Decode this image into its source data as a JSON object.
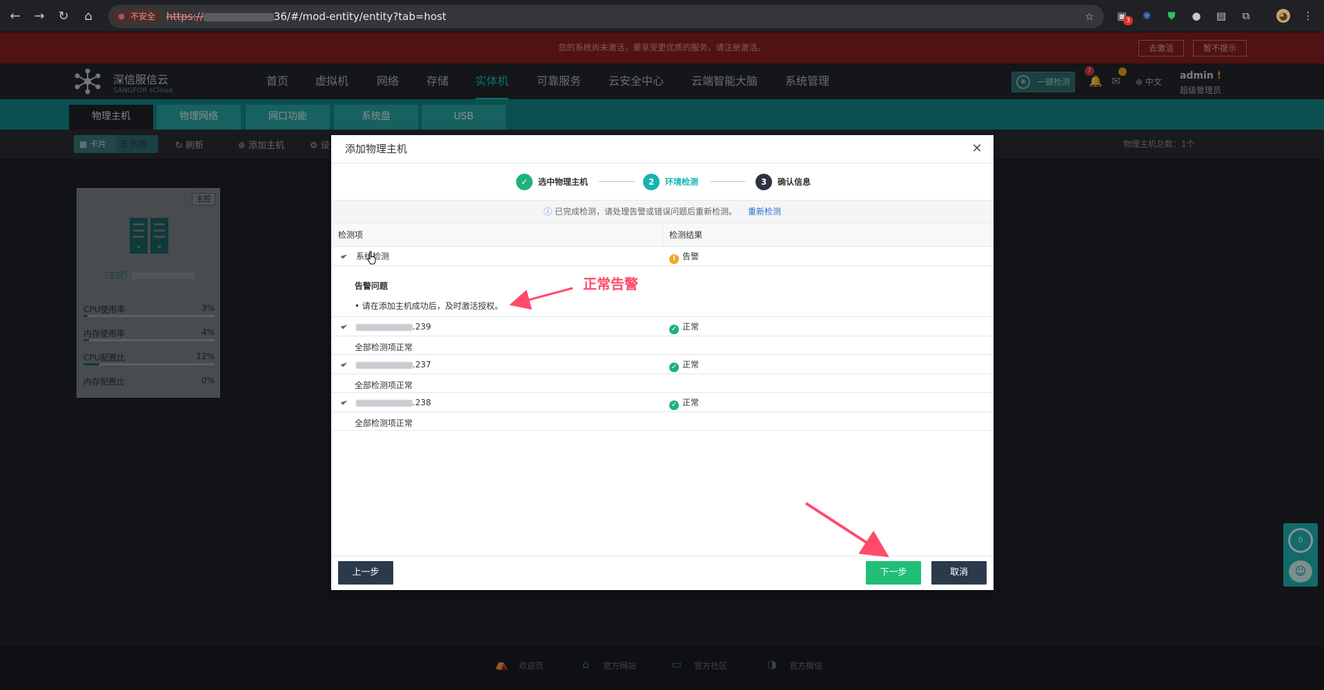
{
  "browser": {
    "security_label": "不安全",
    "url_scheme": "https://",
    "url_rest": "36/#/mod-entity/entity?tab=host",
    "ext_badge": "3"
  },
  "activation_bar": {
    "message": "您的系统尚未激活，要享受更优质的服务，请注册激活。",
    "activate_btn": "去激活",
    "dismiss_btn": "暂不提示"
  },
  "header": {
    "brand_name": "深信服信云",
    "brand_sub": "SANGFOR sCloud",
    "nav": [
      "首页",
      "虚拟机",
      "网络",
      "存储",
      "实体机",
      "可靠服务",
      "云安全中心",
      "云端智能大脑",
      "系统管理"
    ],
    "active_nav": "实体机",
    "one_check": "一键检测",
    "alert_count": "7",
    "language": "中文",
    "user": "admin",
    "user_mark": "!",
    "role": "超级管理员"
  },
  "subtabs": [
    "物理主机",
    "物理网络",
    "网口功能",
    "系统盘",
    "USB"
  ],
  "toolbar": {
    "card_view": "卡片",
    "list_view": "列表",
    "refresh": "刷新",
    "add_host": "添加主机",
    "settings": "设",
    "host_total": "物理主机总数：1个"
  },
  "host_card": {
    "badge": "主控",
    "title_prefix": "(主控)",
    "metrics": [
      {
        "label": "CPU使用率",
        "value": "3%",
        "fraction": 0.03
      },
      {
        "label": "内存使用率",
        "value": "4%",
        "fraction": 0.04
      },
      {
        "label": "CPU配置比",
        "value": "12%",
        "fraction": 0.12
      },
      {
        "label": "内存配置比",
        "value": "0%",
        "fraction": 0.0
      }
    ]
  },
  "modal": {
    "title": "添加物理主机",
    "steps": [
      {
        "num": "✓",
        "label": "选中物理主机",
        "state": "done"
      },
      {
        "num": "2",
        "label": "环境检测",
        "state": "current"
      },
      {
        "num": "3",
        "label": "确认信息",
        "state": "pending"
      }
    ],
    "notice": "已完成检测，请处理告警或错误问题后重新检测。",
    "recheck": "重新检测",
    "col_item": "检测项",
    "col_result": "检测结果",
    "system_row": {
      "name": "系统检测",
      "result": "告警"
    },
    "warn_title": "告警问题",
    "warn_item": "请在添加主机成功后，及时激活授权。",
    "hosts": [
      {
        "ip_suffix": ".239",
        "result": "正常",
        "detail": "全部检测项正常"
      },
      {
        "ip_suffix": ".237",
        "result": "正常",
        "detail": "全部检测项正常"
      },
      {
        "ip_suffix": ".238",
        "result": "正常",
        "detail": "全部检测项正常"
      }
    ],
    "prev_btn": "上一步",
    "next_btn": "下一步",
    "cancel_btn": "取消"
  },
  "annotation": "正常告警",
  "footer": [
    "欢迎页",
    "官方网站",
    "官方社区",
    "官方微信"
  ],
  "float_widget_count": "0",
  "colors": {
    "accent": "#17c3c3",
    "next": "#1fbf75",
    "dark_btn": "#2b3a4a",
    "warn": "#f5a623",
    "ok": "#1fb37a",
    "annotation": "#ff4a6a"
  }
}
